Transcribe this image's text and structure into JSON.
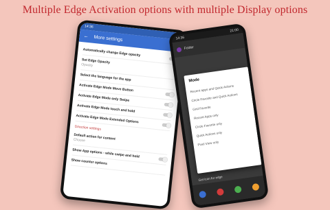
{
  "headline": "Multiple Edge Activation options with multiple Display options",
  "left_phone": {
    "status_time": "14:36",
    "status_right": "●",
    "appbar_title": "More settings",
    "items": [
      {
        "title": "Automatically change Edge opacity",
        "subtitle": ""
      },
      {
        "title": "Set Edge Opacity",
        "subtitle": "Opacity"
      },
      {
        "title": "Select the language for the app",
        "subtitle": ""
      },
      {
        "title": "Activate Edge Mode Move Button",
        "subtitle": ""
      },
      {
        "title": "Activate Edge Mode only Swipe",
        "subtitle": ""
      },
      {
        "title": "Activate Edge Mode touch and hold",
        "subtitle": ""
      },
      {
        "title": "Activate Edge Mode Extended Options",
        "subtitle": ""
      }
    ],
    "section_head": "Direction settings",
    "items2": [
      {
        "title": "Default action for content",
        "subtitle": "Choose"
      },
      {
        "title": "Show App options - while swipe and hold",
        "subtitle": ""
      },
      {
        "title": "Show counter options",
        "subtitle": ""
      }
    ]
  },
  "right_phone": {
    "status_time": "14:36",
    "status_right": "21:00",
    "header_label": "Folder",
    "dialog": {
      "title": "Mode",
      "options": [
        "Recent apps and Quick Actions",
        "Circle Favorite and Quick Actions",
        "Grid Favorite",
        "Recent Apps only",
        "Circle Favorite only",
        "Quick Actions only",
        "Pixel View only"
      ]
    },
    "bottom_label": "Get icon for edge"
  },
  "colors": {
    "background": "#f4c6bc",
    "headline": "#c1272d",
    "appbar": "#3a6fd1"
  }
}
